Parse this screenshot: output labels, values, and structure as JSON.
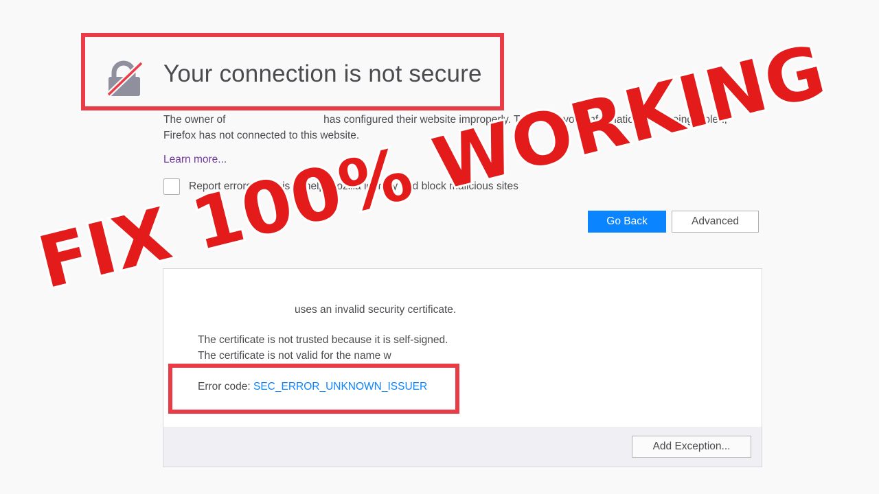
{
  "page": {
    "title": "Your connection is not secure",
    "desc_before": "The owner of ",
    "desc_after": " has configured their website improperly. To protect your information from being stolen, Firefox has not connected to this website.",
    "learn_more": "Learn more...",
    "report_label": "Report errors like this to help Mozilla identify and block malicious sites",
    "report_checked": false,
    "go_back": "Go Back",
    "advanced": "Advanced"
  },
  "advanced_panel": {
    "invalid_cert": "uses an invalid security certificate.",
    "cert_line_1": "The certificate is not trusted because it is self-signed.",
    "cert_line_2": "The certificate is not valid for the name w",
    "error_code_label": "Error code: ",
    "error_code": "SEC_ERROR_UNKNOWN_ISSUER",
    "add_exception": "Add Exception..."
  },
  "overlay": {
    "text": "FIX 100% WORKING"
  },
  "icons": {
    "lock": "broken-lock-icon"
  },
  "colors": {
    "accent": "#0a84ff",
    "highlight": "#ea3c47",
    "overlay_red": "#e31b1b",
    "link_purple": "#6e38a0"
  }
}
